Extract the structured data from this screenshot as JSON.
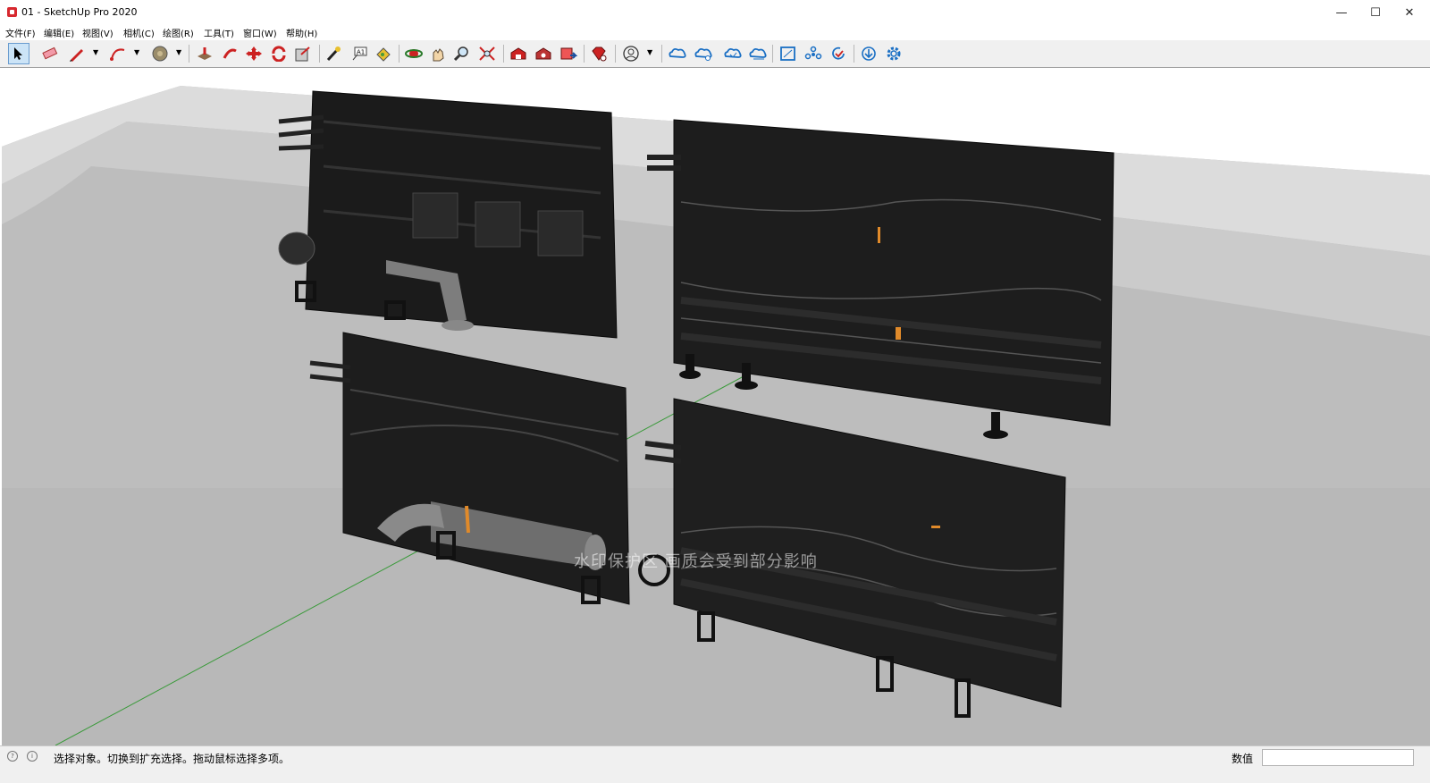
{
  "window": {
    "title": "01 - SketchUp Pro 2020"
  },
  "menu": [
    "文件(F)",
    "编辑(E)",
    "视图(V)",
    "相机(C)",
    "绘图(R)",
    "工具(T)",
    "窗口(W)",
    "帮助(H)"
  ],
  "toolbar": {
    "tools": [
      "select-icon",
      "eraser-icon",
      "pencil-icon",
      "arc-icon",
      "paint-icon",
      "pushpull-icon",
      "followme-icon",
      "move-icon",
      "rotate-icon",
      "scale-icon",
      "tape-icon",
      "text-icon",
      "paint-bucket-icon",
      "orbit-icon",
      "pan-icon",
      "zoom-icon",
      "zoom-extents-icon",
      "warehouse-icon",
      "extension-warehouse-icon",
      "layout-icon",
      "ruby-icon",
      "account-icon",
      "cloud-icon-1",
      "cloud-icon-2",
      "cloud-icon-3",
      "cloud-icon-4",
      "frame-icon",
      "components-icon",
      "update-icon",
      "download-icon",
      "settings-icon"
    ]
  },
  "viewport": {
    "watermark": "水印保护区 画质会受到部分影响"
  },
  "status": {
    "hint": "选择对象。切换到扩充选择。拖动鼠标选择多项。",
    "value_label": "数值"
  },
  "colors": {
    "accent": "#d7282f",
    "toolbar_bg": "#f0f0f0",
    "ground": "#b4b4b4"
  }
}
